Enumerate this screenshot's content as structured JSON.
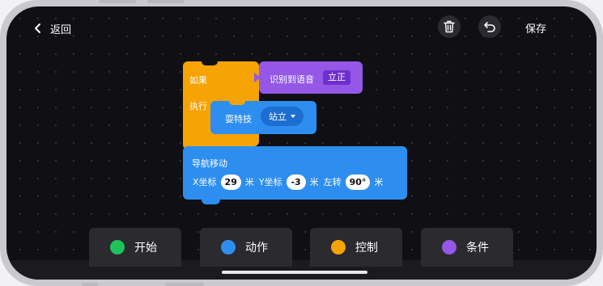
{
  "topbar": {
    "back_label": "返回",
    "save_label": "保存",
    "delete_icon": "trash-icon",
    "undo_icon": "undo-icon"
  },
  "if_block": {
    "if_label": "如果",
    "exec_label": "执行",
    "condition": {
      "label": "识别到语音",
      "value": "立正"
    }
  },
  "trick_block": {
    "label": "耍特技",
    "selected": "站立"
  },
  "nav_block": {
    "title": "导航移动",
    "x_label": "X坐标",
    "x_value": "29",
    "x_unit": "米",
    "y_label": "Y坐标",
    "y_value": "-3",
    "y_unit": "米",
    "turn_label": "左转",
    "turn_value": "90°",
    "turn_unit": "米"
  },
  "categories": [
    {
      "label": "开始",
      "color": "#1ec25a"
    },
    {
      "label": "动作",
      "color": "#2e8ef0"
    },
    {
      "label": "控制",
      "color": "#f5a305"
    },
    {
      "label": "条件",
      "color": "#9457e6"
    }
  ],
  "colors": {
    "control": "#f5a305",
    "condition": "#9457e6",
    "action": "#2e8ef0",
    "background": "#0f0f14"
  }
}
